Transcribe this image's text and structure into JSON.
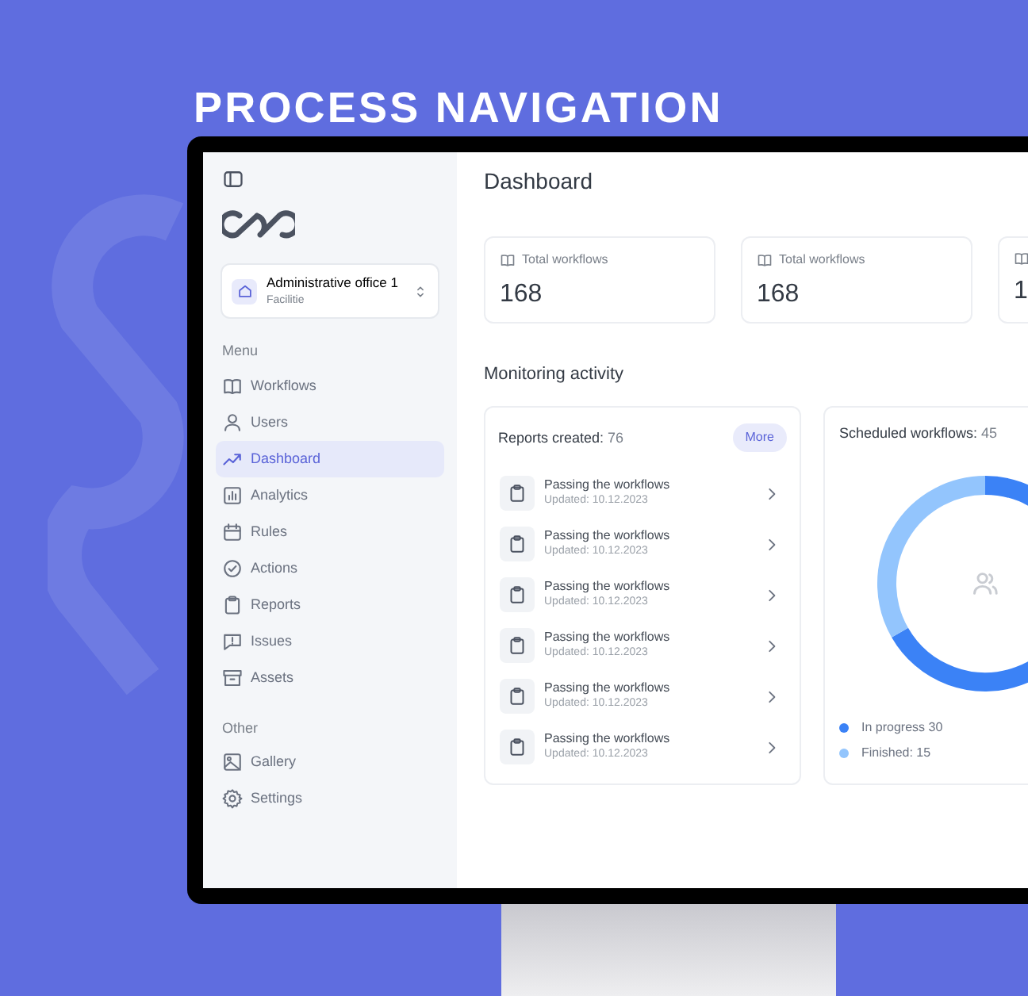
{
  "banner": {
    "title": "PROCESS NAVIGATION"
  },
  "sidebar": {
    "office": {
      "name": "Administrative office 1",
      "type": "Facilitie"
    },
    "sections": [
      {
        "heading": "Menu",
        "items": [
          {
            "label": "Workflows",
            "selected": false
          },
          {
            "label": "Users",
            "selected": false
          },
          {
            "label": "Dashboard",
            "selected": true
          },
          {
            "label": "Analytics",
            "selected": false
          },
          {
            "label": "Rules",
            "selected": false
          },
          {
            "label": "Actions",
            "selected": false
          },
          {
            "label": "Reports",
            "selected": false
          },
          {
            "label": "Issues",
            "selected": false
          },
          {
            "label": "Assets",
            "selected": false
          }
        ]
      },
      {
        "heading": "Other",
        "items": [
          {
            "label": "Gallery",
            "selected": false
          },
          {
            "label": "Settings",
            "selected": false
          }
        ]
      }
    ]
  },
  "page": {
    "title": "Dashboard"
  },
  "stats": [
    {
      "label": "Total workflows",
      "value": "168"
    },
    {
      "label": "Total workflows",
      "value": "168"
    },
    {
      "value": "1"
    }
  ],
  "monitoring": {
    "title": "Monitoring activity",
    "reports": {
      "title": "Reports created:",
      "count": "76",
      "button": "More",
      "items": [
        {
          "title": "Passing the workflows",
          "updated": "Updated: 10.12.2023"
        },
        {
          "title": "Passing the workflows",
          "updated": "Updated: 10.12.2023"
        },
        {
          "title": "Passing the workflows",
          "updated": "Updated: 10.12.2023"
        },
        {
          "title": "Passing the workflows",
          "updated": "Updated: 10.12.2023"
        },
        {
          "title": "Passing the workflows",
          "updated": "Updated: 10.12.2023"
        },
        {
          "title": "Passing the workflows",
          "updated": "Updated: 10.12.2023"
        }
      ]
    },
    "scheduled": {
      "title": "Scheduled workflows:",
      "count": "45",
      "legend": [
        {
          "label": "In progress 30",
          "color": "#3b82f6"
        },
        {
          "label": "Finished: 15",
          "color": "#93c5fd"
        }
      ]
    }
  }
}
